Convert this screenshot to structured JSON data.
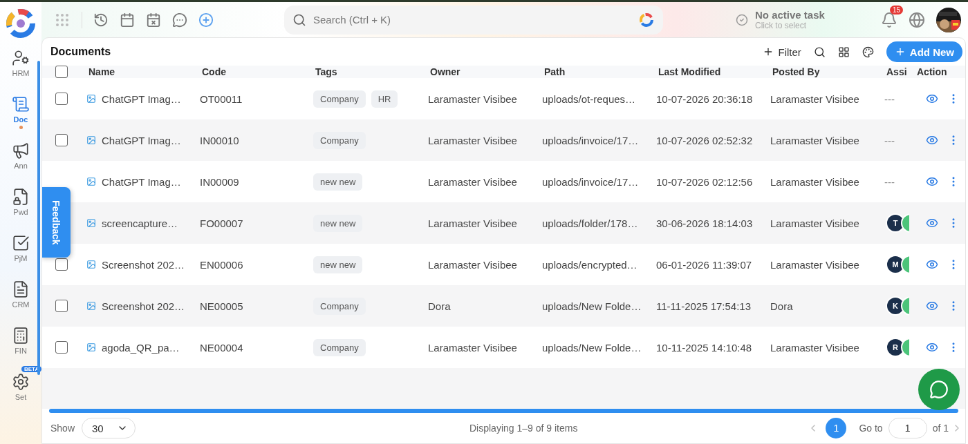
{
  "sidebar": {
    "items": [
      {
        "label": "HRM",
        "selected": false
      },
      {
        "label": "Doc",
        "selected": true
      },
      {
        "label": "Ann",
        "selected": false
      },
      {
        "label": "Pwd",
        "selected": false
      },
      {
        "label": "PjM",
        "selected": false
      },
      {
        "label": "CRM",
        "selected": false
      },
      {
        "label": "FIN",
        "selected": false
      },
      {
        "label": "Set",
        "selected": false,
        "badge": "BETA"
      }
    ]
  },
  "topbar": {
    "search": {
      "placeholder": "Search (Ctrl + K)"
    },
    "task": {
      "title": "No active task",
      "hint": "Click to select"
    },
    "notifications": "15"
  },
  "page": {
    "title": "Documents",
    "toolbar": {
      "filter": "Filter",
      "add": "Add New"
    }
  },
  "table": {
    "select_all": {
      "checked": false
    },
    "columns": [
      "Name",
      "Code",
      "Tags",
      "Owner",
      "Path",
      "Last Modified",
      "Posted By",
      "Assi",
      "Action"
    ],
    "rows": [
      {
        "checked": false,
        "name": "ChatGPT Imag…",
        "code": "OT00011",
        "tags": [
          "Company",
          "HR"
        ],
        "owner": "Laramaster Visibee",
        "path": "uploads/ot-reques…",
        "modified": "10-07-2026 20:36:18",
        "posted_by": "Laramaster Visibee",
        "assigned": "---"
      },
      {
        "checked": false,
        "name": "ChatGPT Imag…",
        "code": "IN00010",
        "tags": [
          "Company"
        ],
        "owner": "Laramaster Visibee",
        "path": "uploads/invoice/17…",
        "modified": "10-07-2026 02:52:32",
        "posted_by": "Laramaster Visibee",
        "assigned": "---"
      },
      {
        "name": "ChatGPT Imag…",
        "code": "IN00009",
        "tags": [
          "new new"
        ],
        "owner": "Laramaster Visibee",
        "path": "uploads/invoice/17…",
        "modified": "10-07-2026 02:12:56",
        "posted_by": "Laramaster Visibee",
        "assigned": "---"
      },
      {
        "name": "screencapture…",
        "code": "FO00007",
        "tags": [
          "new new"
        ],
        "owner": "Laramaster Visibee",
        "path": "uploads/folder/178…",
        "modified": "30-06-2026 18:14:03",
        "posted_by": "Laramaster Visibee",
        "assignees": [
          {
            "initial": "T",
            "color": "#1b2f4b"
          },
          {
            "color": "#4cc47a"
          }
        ]
      },
      {
        "checked": false,
        "name": "Screenshot 202…",
        "code": "EN00006",
        "tags": [
          "new new"
        ],
        "owner": "Laramaster Visibee",
        "path": "uploads/encrypted…",
        "modified": "06-01-2026 11:39:07",
        "posted_by": "Laramaster Visibee",
        "assignees": [
          {
            "initial": "M",
            "color": "#1b2f4b"
          },
          {
            "color": "#4cc47a"
          }
        ]
      },
      {
        "checked": false,
        "name": "Screenshot 202…",
        "code": "NE00005",
        "tags": [
          "Company"
        ],
        "owner": "Dora",
        "path": "uploads/New Folde…",
        "modified": "11-11-2025 17:54:13",
        "posted_by": "Dora",
        "assignees": [
          {
            "initial": "K",
            "color": "#1b2f4b"
          },
          {
            "color": "#4cc47a"
          }
        ]
      },
      {
        "checked": false,
        "name": "agoda_QR_pa…",
        "code": "NE00004",
        "tags": [
          "Company"
        ],
        "owner": "Laramaster Visibee",
        "path": "uploads/New Folde…",
        "modified": "10-11-2025 14:10:48",
        "posted_by": "Laramaster Visibee",
        "assignees": [
          {
            "initial": "R",
            "color": "#1b2f4b"
          },
          {
            "color": "#4cc47a"
          }
        ]
      }
    ]
  },
  "feedback": "Feedback",
  "footer": {
    "show_label": "Show",
    "page_size": "30",
    "summary": "Displaying 1–9 of 9 items",
    "pages": [
      {
        "label": "1",
        "selected": true
      }
    ],
    "goto_label": "Go to",
    "goto_value": "1",
    "of": "of 1"
  }
}
